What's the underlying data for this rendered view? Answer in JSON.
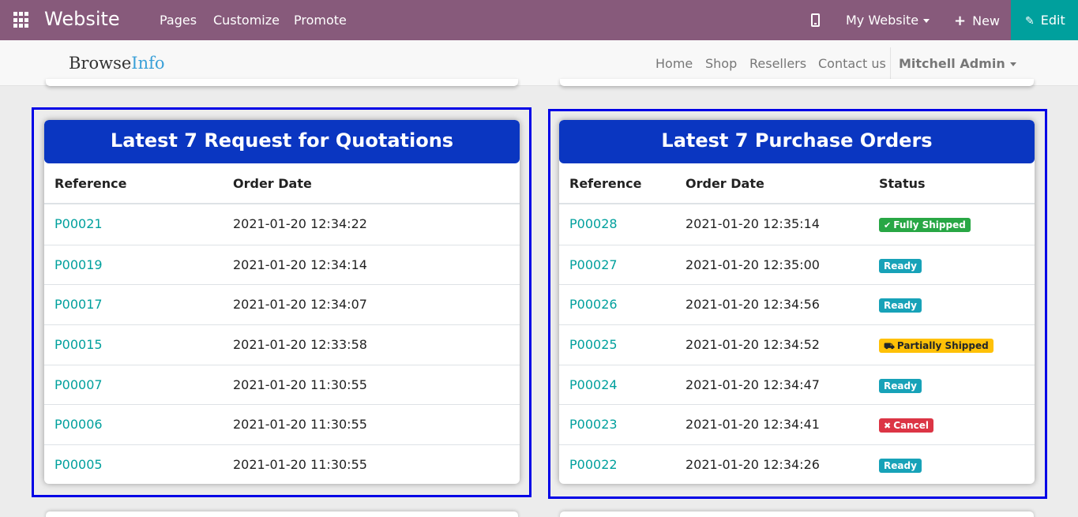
{
  "topbar": {
    "brand": "Website",
    "menu": [
      "Pages",
      "Customize",
      "Promote"
    ],
    "site_selector": "My Website",
    "new_label": "New",
    "edit_label": "Edit",
    "bg_color": "#875a7b",
    "edit_color": "#00a09d"
  },
  "navbar": {
    "logo_part1": "Browse",
    "logo_part2": "Info",
    "links": [
      "Home",
      "Shop",
      "Resellers",
      "Contact us"
    ],
    "user": "Mitchell Admin"
  },
  "rfq": {
    "title": "Latest 7 Request for Quotations",
    "columns": [
      "Reference",
      "Order Date"
    ],
    "rows": [
      {
        "ref": "P00021",
        "date": "2021-01-20 12:34:22"
      },
      {
        "ref": "P00019",
        "date": "2021-01-20 12:34:14"
      },
      {
        "ref": "P00017",
        "date": "2021-01-20 12:34:07"
      },
      {
        "ref": "P00015",
        "date": "2021-01-20 12:33:58"
      },
      {
        "ref": "P00007",
        "date": "2021-01-20 11:30:55"
      },
      {
        "ref": "P00006",
        "date": "2021-01-20 11:30:55"
      },
      {
        "ref": "P00005",
        "date": "2021-01-20 11:30:55"
      }
    ]
  },
  "po": {
    "title": "Latest 7 Purchase Orders",
    "columns": [
      "Reference",
      "Order Date",
      "Status"
    ],
    "rows": [
      {
        "ref": "P00028",
        "date": "2021-01-20 12:35:14",
        "status": "Fully Shipped",
        "icon": "check-icon",
        "kind": "success"
      },
      {
        "ref": "P00027",
        "date": "2021-01-20 12:35:00",
        "status": "Ready",
        "icon": "",
        "kind": "info"
      },
      {
        "ref": "P00026",
        "date": "2021-01-20 12:34:56",
        "status": "Ready",
        "icon": "",
        "kind": "info"
      },
      {
        "ref": "P00025",
        "date": "2021-01-20 12:34:52",
        "status": "Partially Shipped",
        "icon": "truck-icon",
        "kind": "warning"
      },
      {
        "ref": "P00024",
        "date": "2021-01-20 12:34:47",
        "status": "Ready",
        "icon": "",
        "kind": "info"
      },
      {
        "ref": "P00023",
        "date": "2021-01-20 12:34:41",
        "status": "Cancel",
        "icon": "times-icon",
        "kind": "danger"
      },
      {
        "ref": "P00022",
        "date": "2021-01-20 12:34:26",
        "status": "Ready",
        "icon": "",
        "kind": "info"
      }
    ]
  },
  "colors": {
    "card_header": "#0a36c1",
    "highlight_border": "#0000e6",
    "link": "#00a09d"
  }
}
